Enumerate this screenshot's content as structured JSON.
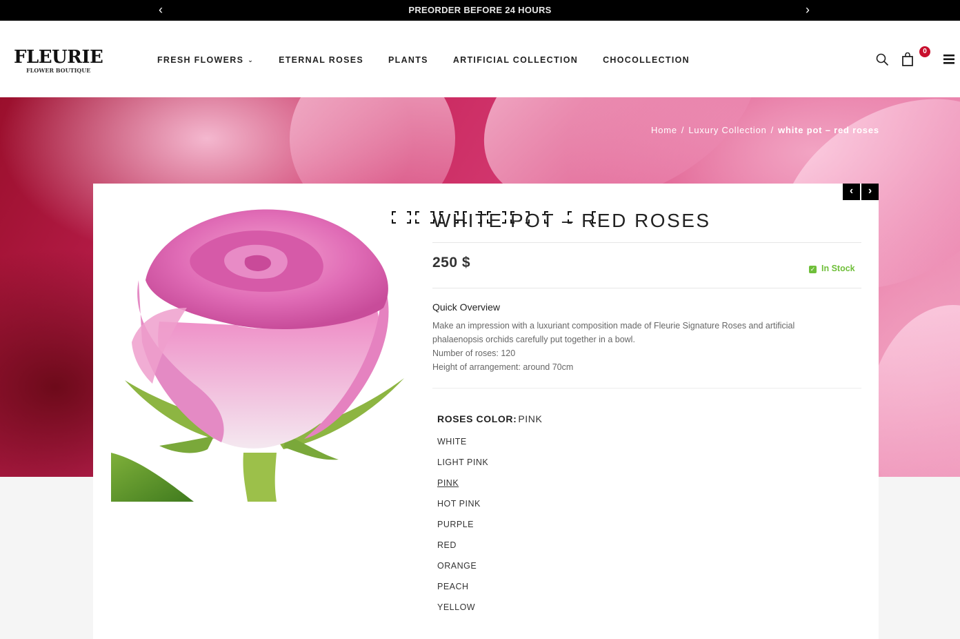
{
  "topbar": {
    "message": "PREORDER BEFORE 24 HOURS",
    "prev_glyph": "‹",
    "next_glyph": "›"
  },
  "header": {
    "logo_main": "FLEURIE",
    "logo_sub": "FLOWER BOUTIQUE",
    "nav": [
      {
        "label": "FRESH FLOWERS",
        "has_dropdown": true
      },
      {
        "label": "ETERNAL ROSES"
      },
      {
        "label": "PLANTS"
      },
      {
        "label": "ARTIFICIAL COLLECTION"
      },
      {
        "label": "CHOCOLLECTION"
      }
    ],
    "dropdown_glyph": "⌄",
    "icons": [
      "search-icon",
      "shopping-bag-icon",
      "menu-icon"
    ],
    "cart_count": "0",
    "badge_color": "#c8102e"
  },
  "breadcrumb": {
    "home": "Home",
    "sep": "/",
    "collection": "Luxury Collection",
    "current": "white pot – red roses"
  },
  "product_nav": {
    "prev": "‹",
    "next": "›"
  },
  "product": {
    "title": "WHITE POT – RED ROSES",
    "price": "250 $",
    "stock": "In Stock",
    "stock_color": "#6fbf3a",
    "overview_title": "Quick Overview",
    "overview_lines": [
      "Make an impression with a luxuriant composition made of Fleurie Signature Roses and artificial",
      "phalaenopsis orchids carefully put together in a bowl.",
      "Number of roses: 120",
      "Height of arrangement: around 70cm"
    ],
    "color_label": "ROSES COLOR",
    "color_selected": "PINK",
    "color_options": [
      "WHITE",
      "LIGHT PINK",
      "PINK",
      "HOT PINK",
      "PURPLE",
      "RED",
      "ORANGE",
      "PEACH",
      "YELLOW"
    ]
  }
}
